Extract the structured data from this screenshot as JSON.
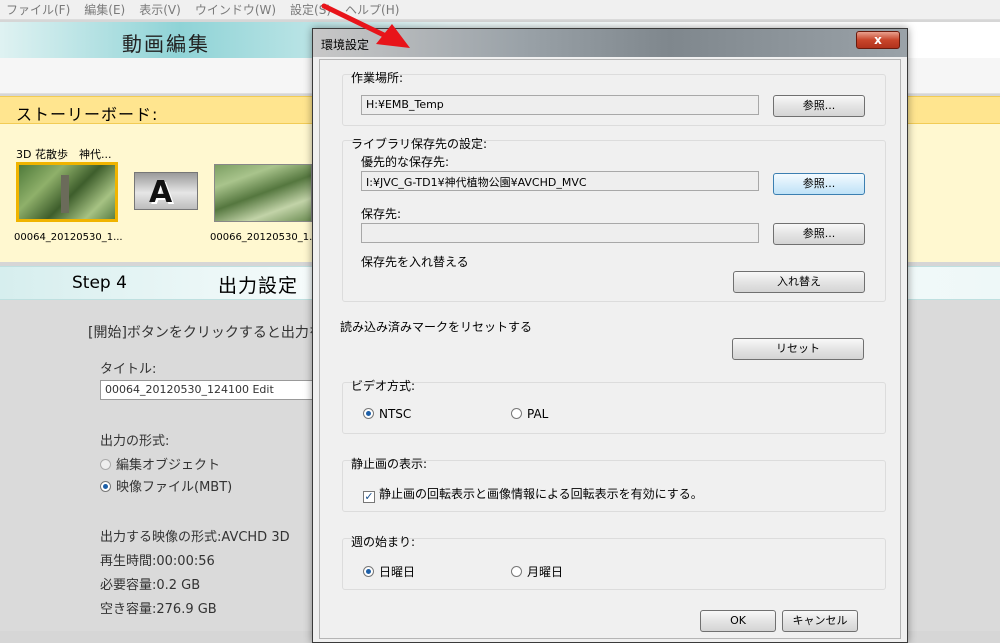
{
  "menubar": {
    "items": [
      "ファイル(F)",
      "編集(E)",
      "表示(V)",
      "ウインドウ(W)",
      "設定(S)",
      "ヘルプ(H)"
    ]
  },
  "app": {
    "title": "動画編集",
    "storyboard_label": "ストーリーボード:",
    "clip_title": "3D 花散歩　神代...",
    "clips": [
      "00064_20120530_1...",
      "00066_20120530_1..."
    ],
    "step_label": "Step 4",
    "step_title": "出力設定",
    "instruction": "[開始]ボタンをクリックすると出力を",
    "title_label": "タイトル:",
    "title_value": "00064_20120530_124100 Edit",
    "format_label": "出力の形式:",
    "format_options": [
      "編集オブジェクト",
      "映像ファイル(MBT)"
    ],
    "output_format": "出力する映像の形式:AVCHD 3D",
    "duration": "再生時間:00:00:56",
    "required": "必要容量:0.2 GB",
    "free": "空き容量:276.9 GB"
  },
  "dialog": {
    "title": "環境設定",
    "close_label": "x",
    "work_location": {
      "label": "作業場所:",
      "value": "H:¥EMB_Temp",
      "browse": "参照..."
    },
    "library": {
      "label": "ライブラリ保存先の設定:",
      "priority_label": "優先的な保存先:",
      "priority_value": "I:¥JVC_G-TD1¥神代植物公園¥AVCHD_MVC",
      "priority_browse": "参照...",
      "dest_label": "保存先:",
      "dest_value": "",
      "dest_browse": "参照...",
      "swap_label": "保存先を入れ替える",
      "swap_button": "入れ替え"
    },
    "reset": {
      "label": "読み込み済みマークをリセットする",
      "button": "リセット"
    },
    "video": {
      "label": "ビデオ方式:",
      "options": [
        "NTSC",
        "PAL"
      ],
      "selected": "NTSC"
    },
    "still": {
      "label": "静止画の表示:",
      "checkbox": "静止画の回転表示と画像情報による回転表示を有効にする。",
      "checked": true
    },
    "week": {
      "label": "週の始まり:",
      "options": [
        "日曜日",
        "月曜日"
      ],
      "selected": "日曜日"
    },
    "ok": "OK",
    "cancel": "キャンセル"
  }
}
